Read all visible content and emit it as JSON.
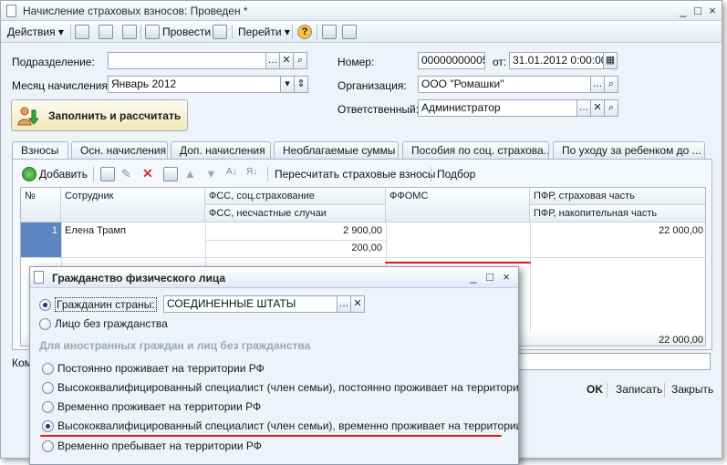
{
  "window": {
    "title": "Начисление страховых взносов: Проведен *",
    "buttons": [
      "_",
      "□",
      "×"
    ]
  },
  "toolbar": {
    "actions": "Действия",
    "post": "Провести",
    "goto": "Перейти",
    "help": "?"
  },
  "form": {
    "division_label": "Подразделение:",
    "division_value": "",
    "month_label": "Месяц начисления:",
    "month_value": "Январь 2012",
    "number_label": "Номер:",
    "number_value": "00000000005",
    "from_label": "от:",
    "date_value": "31.01.2012  0:00:00",
    "org_label": "Организация:",
    "org_value": "ООО \"Ромашки\"",
    "responsible_label": "Ответственный:",
    "responsible_value": "Администратор",
    "fill_button": "Заполнить и рассчитать",
    "comment_label": "Ком"
  },
  "tabs": [
    "Взносы",
    "Осн. начисления",
    "Доп. начисления",
    "Необлагаемые суммы",
    "Пособия по соц. страхова...",
    "По уходу за ребенком до ..."
  ],
  "subtoolbar": {
    "add": "Добавить",
    "recalc": "Пересчитать страховые взносы",
    "select": "Подбор"
  },
  "grid": {
    "headers": {
      "num": "№",
      "employee": "Сотрудник",
      "fss": "ФСС, соц.страхование",
      "fss_acc": "ФСС, несчастные случаи",
      "ffoms": "ФФОМС",
      "pfr": "ПФР, страховая часть",
      "pfr_acc": "ПФР, накопительная часть"
    },
    "rows": [
      {
        "num": "1",
        "employee": "Елена Трамп",
        "fss": "2 900,00",
        "fss_acc": "200,00",
        "ffoms": "",
        "pfr": "22 000,00",
        "pfr_acc": ""
      }
    ],
    "total_pfr": "22 000,00"
  },
  "bottom": {
    "ok": "OK",
    "save": "Записать",
    "close": "Закрыть"
  },
  "dialog": {
    "title": "Гражданство физического лица",
    "citizen_label": "Гражданин страны:",
    "country_value": "СОЕДИНЕННЫЕ ШТАТЫ",
    "stateless_label": "Лицо без гражданства",
    "group_label": "Для иностранных граждан и лиц без гражданства",
    "options": [
      "Постоянно проживает на территории РФ",
      "Высококвалифицированный специалист (член семьи), постоянно проживает на территории РФ",
      "Временно проживает на территории РФ",
      "Высококвалифицированный специалист (член семьи), временно проживает на территории РФ",
      "Временно пребывает на территории РФ"
    ],
    "selected_option_index": 3
  },
  "colors": {
    "accent_red": "#e01818",
    "window_bg": "#eef3f9",
    "selected_row_num": "#5d86c2"
  }
}
